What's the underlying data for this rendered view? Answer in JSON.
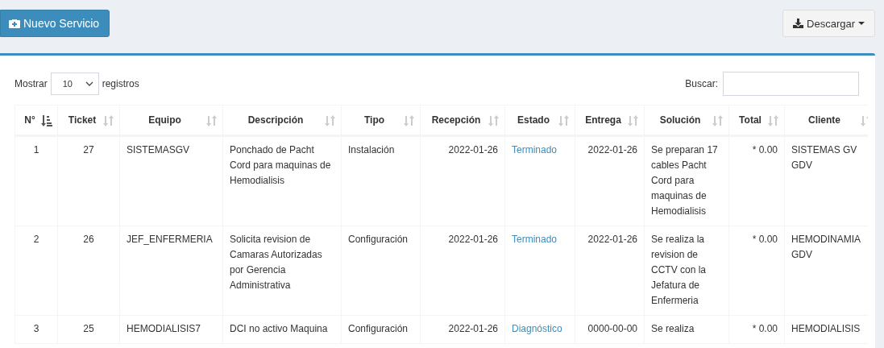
{
  "toolbar": {
    "new_button": "Nuevo Servicio",
    "download_button": "Descargar"
  },
  "table_controls": {
    "show_label": "Mostrar",
    "page_size": "10",
    "show_suffix": "registros",
    "search_label": "Buscar:"
  },
  "table": {
    "columns": [
      {
        "label": "N°",
        "sorted": true
      },
      {
        "label": "Ticket",
        "sorted": false
      },
      {
        "label": "Equipo",
        "sorted": false
      },
      {
        "label": "Descripción",
        "sorted": false
      },
      {
        "label": "Tipo",
        "sorted": false
      },
      {
        "label": "Recepción",
        "sorted": false
      },
      {
        "label": "Estado",
        "sorted": false
      },
      {
        "label": "Entrega",
        "sorted": false
      },
      {
        "label": "Solución",
        "sorted": false
      },
      {
        "label": "Total",
        "sorted": false
      },
      {
        "label": "Cliente",
        "sorted": false
      }
    ],
    "rows": [
      {
        "n": "1",
        "ticket": "27",
        "equipo": "SISTEMASGV",
        "descripcion": "Ponchado de Pacht Cord para maquinas de Hemodialisis",
        "tipo": "Instalación",
        "recepcion": "2022-01-26",
        "estado": "Terminado",
        "entrega": "2022-01-26",
        "solucion": "Se preparan 17 cables Pacht Cord para maquinas de Hemodialisis",
        "total": "* 0.00",
        "cliente": "SISTEMAS GV GDV"
      },
      {
        "n": "2",
        "ticket": "26",
        "equipo": "JEF_ENFERMERIA",
        "descripcion": "Solicita revision de Camaras Autorizadas por Gerencia Administrativa",
        "tipo": "Configuración",
        "recepcion": "2022-01-26",
        "estado": "Terminado",
        "entrega": "2022-01-26",
        "solucion": "Se realiza la revision de CCTV con la Jefatura de Enfermeria",
        "total": "* 0.00",
        "cliente": "HEMODINAMIA GDV"
      },
      {
        "n": "3",
        "ticket": "25",
        "equipo": "HEMODIALISIS7",
        "descripcion": "DCI no activo Maquina",
        "tipo": "Configuración",
        "recepcion": "2022-01-26",
        "estado": "Diagnóstico",
        "entrega": "0000-00-00",
        "solucion": "Se realiza",
        "total": "* 0.00",
        "cliente": "HEMODIALISIS"
      }
    ]
  }
}
